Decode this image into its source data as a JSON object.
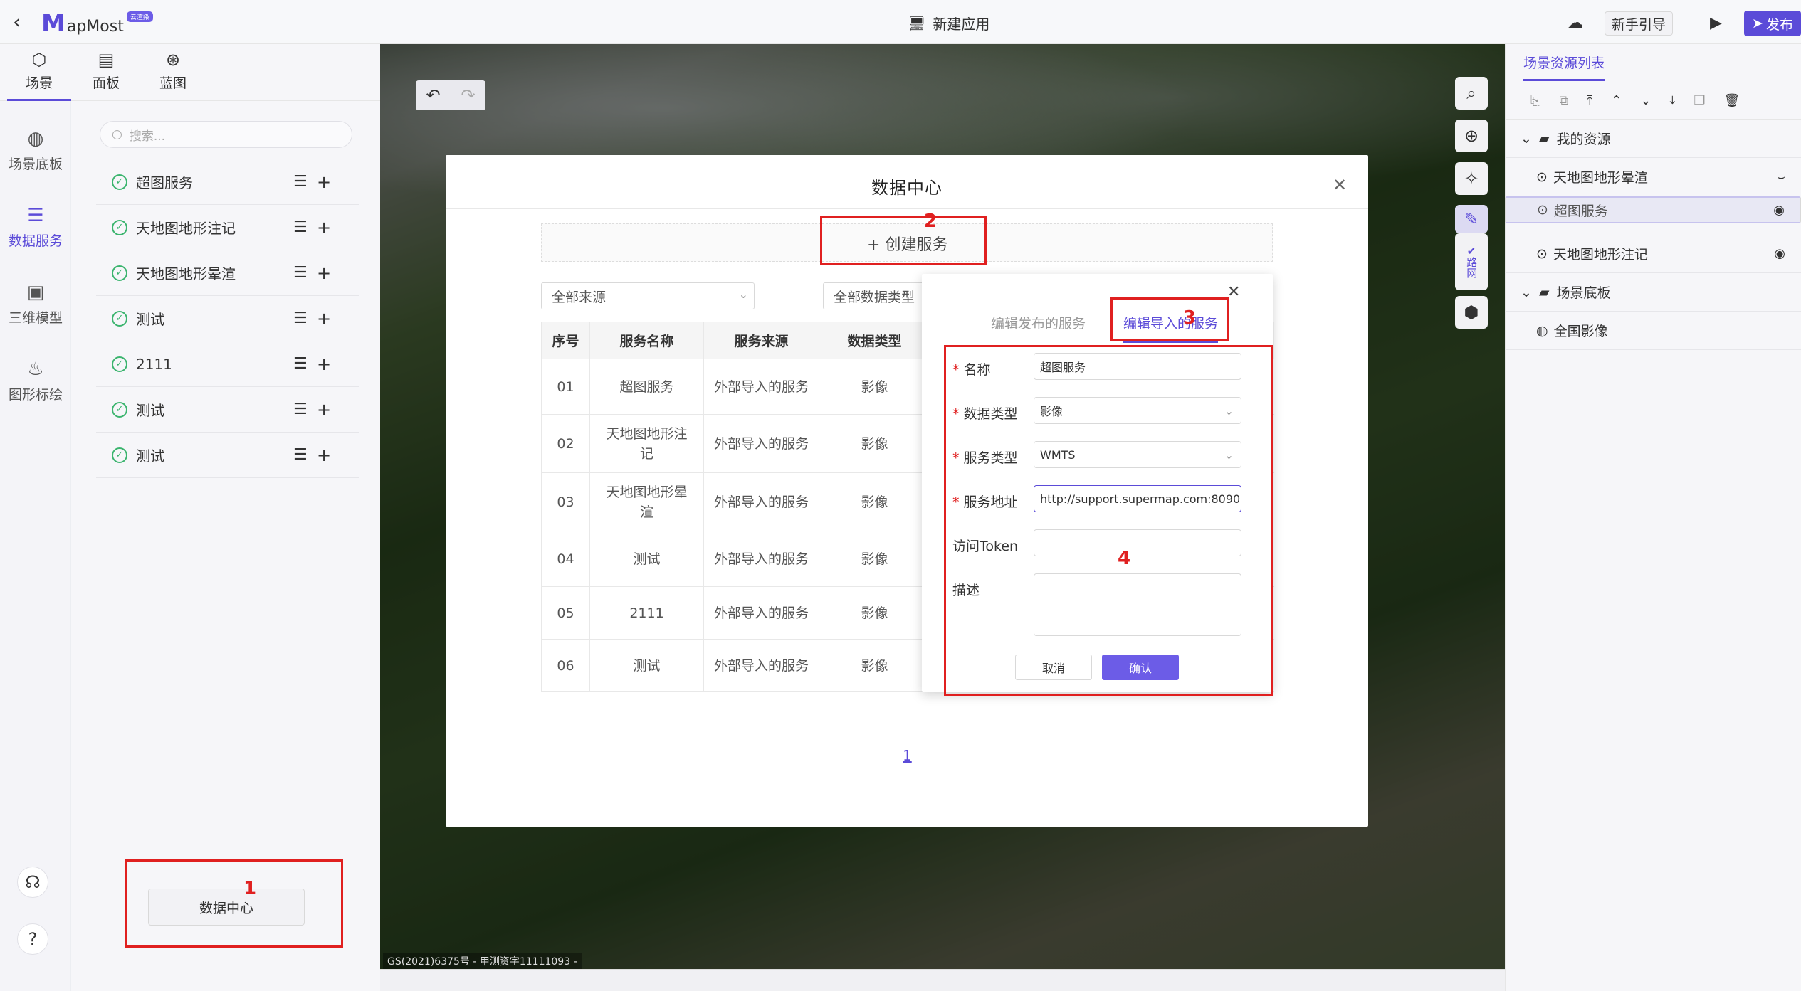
{
  "header": {
    "logo_mark": "M",
    "logo_text": "apMost",
    "logo_tag": "云渲染",
    "app_title": "新建应用",
    "guide_label": "新手引导",
    "publish_label": "发布"
  },
  "left_tabs": [
    {
      "label": "场景",
      "icon": "scene-icon"
    },
    {
      "label": "面板",
      "icon": "panel-icon"
    },
    {
      "label": "蓝图",
      "icon": "blueprint-icon"
    }
  ],
  "left_nav": [
    {
      "label": "场景底板",
      "icon": "globe-icon"
    },
    {
      "label": "数据服务",
      "icon": "database-icon"
    },
    {
      "label": "三维模型",
      "icon": "cube-icon"
    },
    {
      "label": "图形标绘",
      "icon": "draw-icon"
    }
  ],
  "search": {
    "placeholder": "搜索..."
  },
  "services": [
    {
      "name": "超图服务"
    },
    {
      "name": "天地图地形注记"
    },
    {
      "name": "天地图地形晕渲"
    },
    {
      "name": "测试"
    },
    {
      "name": "2111"
    },
    {
      "name": "测试"
    },
    {
      "name": "测试"
    }
  ],
  "data_center_button": "数据中心",
  "annotations": {
    "n1": "1",
    "n2": "2",
    "n3": "3",
    "n4": "4"
  },
  "map": {
    "copyright": "GS(2021)6375号 - 甲测资字11111093 -",
    "road_net_label": "路网"
  },
  "right_panel": {
    "title": "场景资源列表",
    "tree": [
      {
        "label": "我的资源",
        "type": "folder"
      },
      {
        "label": "天地图地形晕渲",
        "type": "item",
        "eye": "hidden"
      },
      {
        "label": "超图服务",
        "type": "item",
        "eye": "visible",
        "selected": true
      },
      {
        "label": "天地图地形注记",
        "type": "item",
        "eye": "visible"
      },
      {
        "label": "场景底板",
        "type": "folder"
      },
      {
        "label": "全国影像",
        "type": "item"
      }
    ]
  },
  "modal": {
    "title": "数据中心",
    "create_label": "创建服务",
    "filter_source": "全部来源",
    "filter_type": "全部数据类型",
    "table_headers": [
      "序号",
      "服务名称",
      "服务来源",
      "数据类型"
    ],
    "rows": [
      [
        "01",
        "超图服务",
        "外部导入的服务",
        "影像"
      ],
      [
        "02",
        "天地图地形注记",
        "外部导入的服务",
        "影像"
      ],
      [
        "03",
        "天地图地形晕渲",
        "外部导入的服务",
        "影像"
      ],
      [
        "04",
        "测试",
        "外部导入的服务",
        "影像"
      ],
      [
        "05",
        "2111",
        "外部导入的服务",
        "影像"
      ],
      [
        "06",
        "测试",
        "外部导入的服务",
        "影像"
      ]
    ],
    "page": "1"
  },
  "dialog": {
    "tab_publish": "编辑发布的服务",
    "tab_import": "编辑导入的服务",
    "fields": {
      "name_label": "名称",
      "name_value": "超图服务",
      "data_type_label": "数据类型",
      "data_type_value": "影像",
      "service_type_label": "服务类型",
      "service_type_value": "WMTS",
      "url_label": "服务地址",
      "url_value": "http://support.supermap.com:8090",
      "token_label": "访问Token",
      "token_value": "",
      "desc_label": "描述",
      "desc_value": ""
    },
    "cancel_label": "取消",
    "confirm_label": "确认"
  },
  "colors": {
    "accent": "#5b4bd8",
    "highlight": "#e02020",
    "ok": "#3bb46e"
  }
}
